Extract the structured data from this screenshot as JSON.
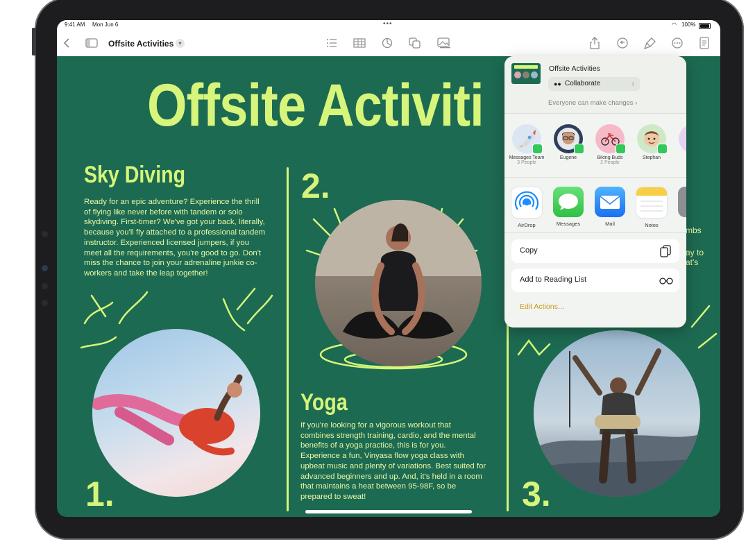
{
  "status_bar": {
    "time": "9:41 AM",
    "date": "Mon Jun 6",
    "battery": "100%"
  },
  "toolbar": {
    "doc_title": "Offsite Activities",
    "left_icons": [
      "back-chevron-icon",
      "sidebar-icon"
    ],
    "center_icons": [
      "list-icon",
      "table-icon",
      "chart-icon",
      "shapes-icon",
      "media-icon"
    ],
    "right_icons": [
      "share-icon",
      "undo-history-icon",
      "format-brush-icon",
      "more-icon",
      "document-icon"
    ]
  },
  "document": {
    "title": "Offsite Activiti",
    "sections": [
      {
        "heading": "Sky Diving",
        "body": "Ready for an epic adventure? Experience the thrill of flying like never before with tandem or solo skydiving. First-timer? We've got your back, literally, because you'll fly attached to a professional tandem instructor. Experienced licensed jumpers, if you meet all the requirements, you're good to go. Don't miss the chance to join your adrenaline junkie co-workers and take the leap together!",
        "number": "1."
      },
      {
        "heading": "Yoga",
        "body": "If you're looking for a vigorous workout that combines strength training, cardio, and the mental benefits of a yoga practice, this is for you. Experience a fun, Vinyasa flow yoga class with upbeat music and plenty of variations. Best suited for advanced beginners and up. And, it's held in a room that maintains a heat between 95-98F, so be prepared to sweat!",
        "number": "2."
      },
      {
        "number": "3.",
        "partial_text_1": "mbs",
        "partial_text_2": "ay to",
        "partial_text_3": "at's"
      }
    ]
  },
  "share_sheet": {
    "title": "Offsite Activities",
    "collaborate_label": "Collaborate",
    "permission_text": "Everyone can make changes",
    "people": [
      {
        "name": "Messages Team",
        "sub": "3 People"
      },
      {
        "name": "Eugene",
        "sub": ""
      },
      {
        "name": "Biking Buds",
        "sub": "2 People"
      },
      {
        "name": "Stephan",
        "sub": ""
      },
      {
        "name": "G",
        "sub": ""
      }
    ],
    "apps": [
      {
        "name": "AirDrop"
      },
      {
        "name": "Messages"
      },
      {
        "name": "Mail"
      },
      {
        "name": "Notes"
      },
      {
        "name": "R"
      }
    ],
    "actions": [
      {
        "label": "Copy",
        "icon": "copy-icon"
      },
      {
        "label": "Add to Reading List",
        "icon": "glasses-icon"
      }
    ],
    "edit_actions_label": "Edit Actions…"
  }
}
